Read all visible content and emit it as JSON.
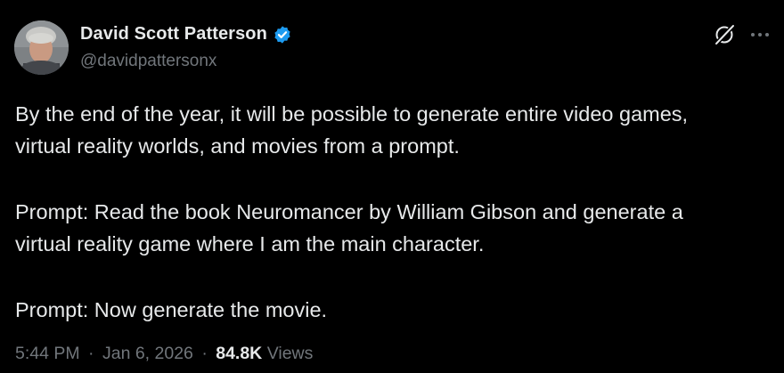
{
  "author": {
    "display_name": "David Scott Patterson",
    "handle": "@davidpattersonx",
    "verified": true,
    "verified_color": "#1d9bf0"
  },
  "actions": {
    "grok_icon": "grok-icon",
    "more_icon": "more-horizontal-icon"
  },
  "tweet": {
    "paragraphs": [
      [
        "By the end of the year, it will be possible to generate entire video games,",
        "virtual reality worlds, and movies from a prompt."
      ],
      [
        "Prompt: Read the book Neuromancer by William Gibson and generate a",
        "virtual reality game where I am the main character."
      ],
      [
        "Prompt: Now generate the movie."
      ]
    ]
  },
  "meta": {
    "time": "5:44 PM",
    "separator": "·",
    "date": "Jan 6, 2026",
    "views_count": "84.8K",
    "views_label": "Views"
  },
  "colors": {
    "background": "#000000",
    "primary_text": "#e7e9ea",
    "secondary_text": "#71767b"
  }
}
